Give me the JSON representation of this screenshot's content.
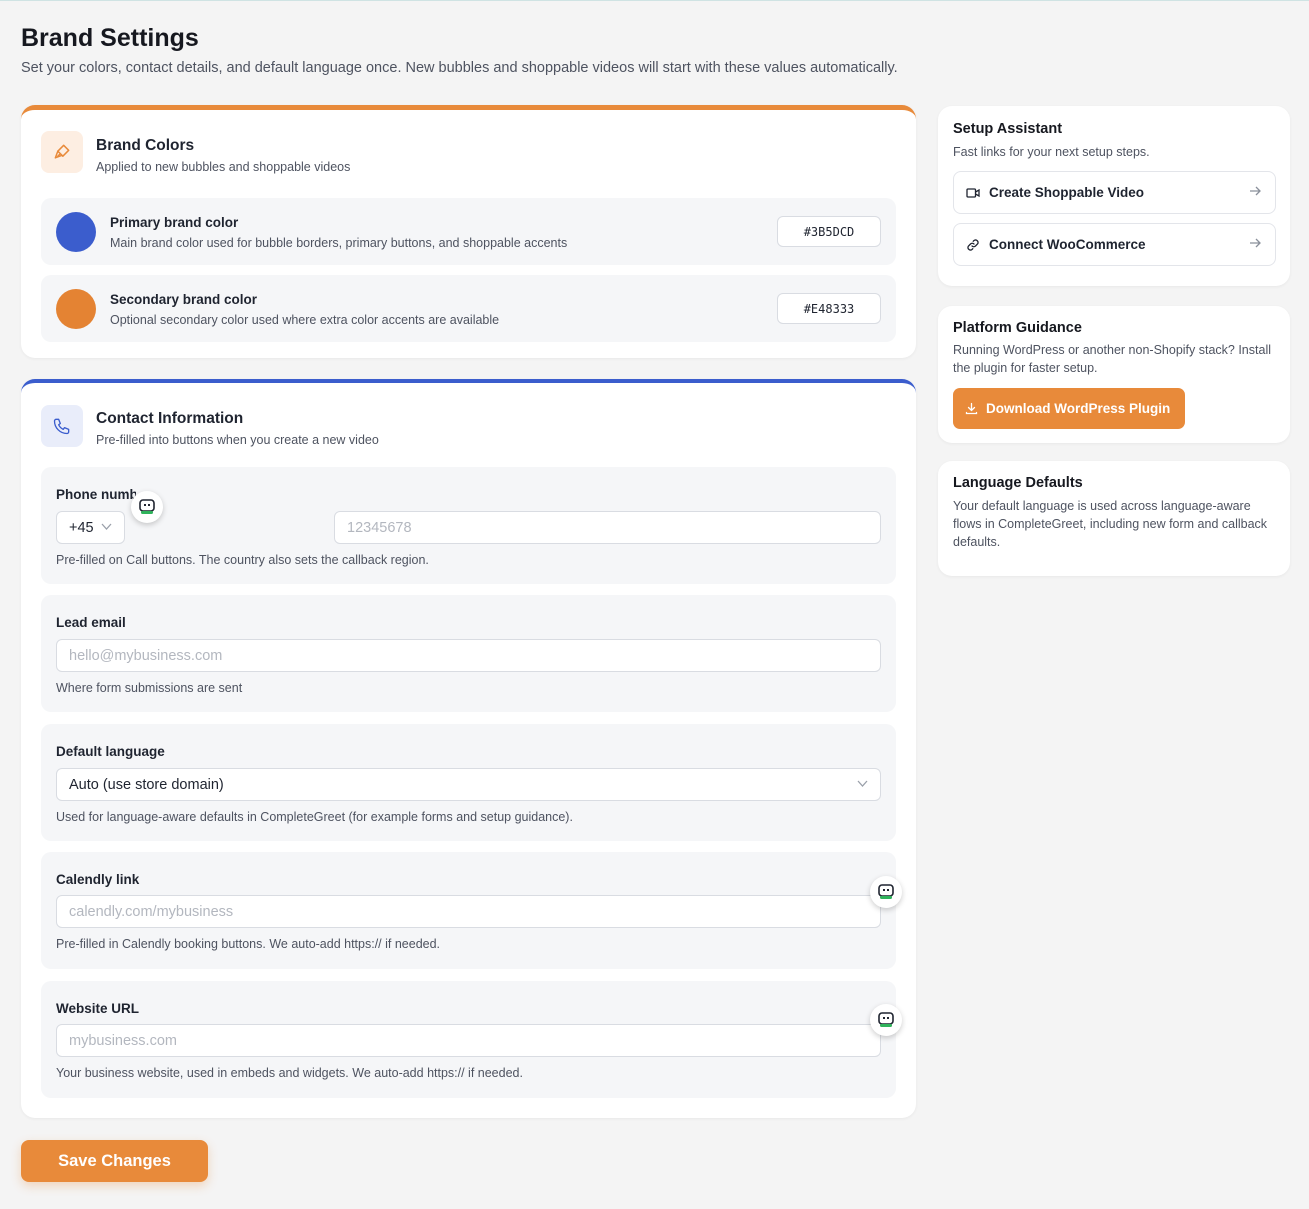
{
  "page": {
    "title": "Brand Settings",
    "subtitle": "Set your colors, contact details, and default language once. New bubbles and shoppable videos will start with these values automatically."
  },
  "brand_colors": {
    "title": "Brand Colors",
    "subtitle": "Applied to new bubbles and shoppable videos",
    "icon": "brush-icon",
    "primary": {
      "title": "Primary brand color",
      "description": "Main brand color used for bubble borders, primary buttons, and shoppable accents",
      "value": "#3B5DCD",
      "color": "#3b5dcd"
    },
    "secondary": {
      "title": "Secondary brand color",
      "description": "Optional secondary color used where extra color accents are available",
      "value": "#E48333",
      "color": "#e48333"
    }
  },
  "contact": {
    "title": "Contact Information",
    "subtitle": "Pre-filled into buttons when you create a new video",
    "icon": "phone-icon",
    "phone": {
      "label": "Phone number",
      "country_code": "+45",
      "placeholder": "12345678",
      "help": "Pre-filled on Call buttons. The country also sets the callback region."
    },
    "email": {
      "label": "Lead email",
      "placeholder": "hello@mybusiness.com",
      "help": "Where form submissions are sent"
    },
    "language": {
      "label": "Default language",
      "value": "Auto (use store domain)",
      "help": "Used for language-aware defaults in CompleteGreet (for example forms and setup guidance)."
    },
    "calendly": {
      "label": "Calendly link",
      "placeholder": "calendly.com/mybusiness",
      "help": "Pre-filled in Calendly booking buttons. We auto-add https:// if needed."
    },
    "website": {
      "label": "Website URL",
      "placeholder": "mybusiness.com",
      "help": "Your business website, used in embeds and widgets. We auto-add https:// if needed."
    }
  },
  "save_label": "Save Changes",
  "sidebar": {
    "setup": {
      "title": "Setup Assistant",
      "subtitle": "Fast links for your next setup steps.",
      "links": [
        {
          "label": "Create Shoppable Video",
          "icon": "video-icon"
        },
        {
          "label": "Connect WooCommerce",
          "icon": "link-icon"
        }
      ]
    },
    "platform": {
      "title": "Platform Guidance",
      "text": "Running WordPress or another non-Shopify stack? Install the plugin for faster setup.",
      "button": "Download WordPress Plugin"
    },
    "language": {
      "title": "Language Defaults",
      "text": "Your default language is used across language-aware flows in CompleteGreet, including new form and callback defaults."
    }
  },
  "colors": {
    "accent_orange": "#e88a3a",
    "accent_blue": "#3b5dcd"
  }
}
